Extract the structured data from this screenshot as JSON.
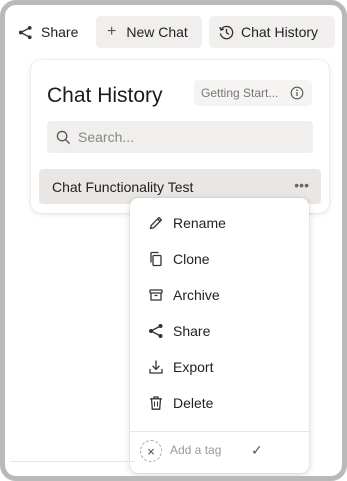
{
  "toolbar": {
    "share_label": "Share",
    "new_chat_label": "New Chat",
    "new_chat_icon": "+",
    "chat_history_label": "Chat History"
  },
  "card": {
    "title": "Chat History",
    "badge_label": "Getting Start...",
    "search_placeholder": "Search...",
    "chat_item": {
      "title": "Chat Functionality Test",
      "more_icon": "•••"
    }
  },
  "menu": {
    "items": [
      {
        "label": "Rename",
        "icon": "pencil-icon"
      },
      {
        "label": "Clone",
        "icon": "copy-icon"
      },
      {
        "label": "Archive",
        "icon": "archive-icon"
      },
      {
        "label": "Share",
        "icon": "share-icon"
      },
      {
        "label": "Export",
        "icon": "download-icon"
      },
      {
        "label": "Delete",
        "icon": "trash-icon"
      }
    ],
    "tag": {
      "placeholder": "Add a tag",
      "clear_icon": "×",
      "confirm_icon": "✓"
    }
  },
  "colors": {
    "button_bg": "#f1efed",
    "row_selected_bg": "#e9e6e3",
    "frame_border": "#b9b9b9"
  }
}
